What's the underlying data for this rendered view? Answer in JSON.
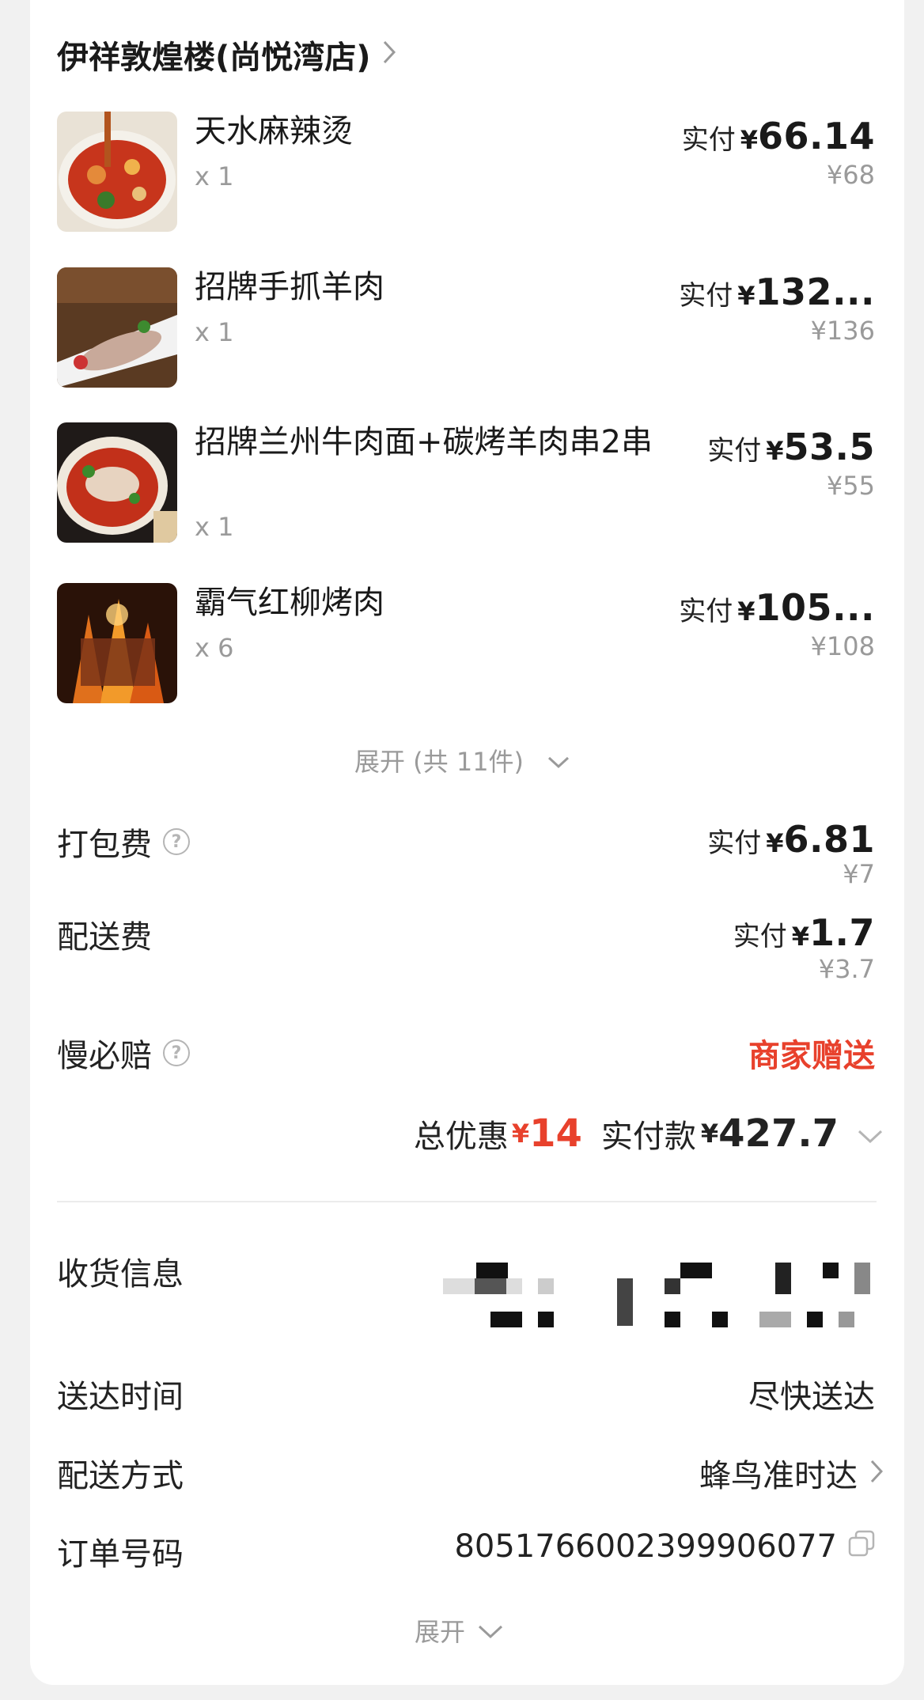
{
  "shop": {
    "name": "伊祥敦煌楼(尚悦湾店)"
  },
  "items": [
    {
      "name": "天水麻辣烫",
      "qty": "x 1",
      "pay_label": "实付",
      "currency": "¥",
      "paid": "66.14",
      "original": "¥68"
    },
    {
      "name": "招牌手抓羊肉",
      "qty": "x 1",
      "pay_label": "实付",
      "currency": "¥",
      "paid": "132...",
      "original": "¥136"
    },
    {
      "name": "招牌兰州牛肉面+碳烤羊肉串2串",
      "qty": "x 1",
      "pay_label": "实付",
      "currency": "¥",
      "paid": "53.5",
      "original": "¥55"
    },
    {
      "name": "霸气红柳烤肉",
      "qty": "x 6",
      "pay_label": "实付",
      "currency": "¥",
      "paid": "105...",
      "original": "¥108"
    }
  ],
  "expand_items": "展开 (共 11件)",
  "fees": {
    "packing": {
      "label": "打包费",
      "pay_label": "实付",
      "currency": "¥",
      "paid": "6.81",
      "original": "¥7"
    },
    "delivery": {
      "label": "配送费",
      "pay_label": "实付",
      "currency": "¥",
      "paid": "1.7",
      "original": "¥3.7"
    },
    "late_comp": {
      "label": "慢必赔",
      "value": "商家赠送"
    }
  },
  "summary": {
    "discount_label": "总优惠",
    "discount_currency": "¥",
    "discount": "14",
    "paid_label": "实付款",
    "paid_currency": "¥",
    "paid": "427.7"
  },
  "info": {
    "address_label": "收货信息",
    "time_label": "送达时间",
    "time_value": "尽快送达",
    "method_label": "配送方式",
    "method_value": "蜂鸟准时达",
    "order_label": "订单号码",
    "order_value": "8051766002399906077"
  },
  "expand_bottom": "展开",
  "colors": {
    "accent_red": "#e8412c",
    "muted": "#9a9a9a"
  }
}
